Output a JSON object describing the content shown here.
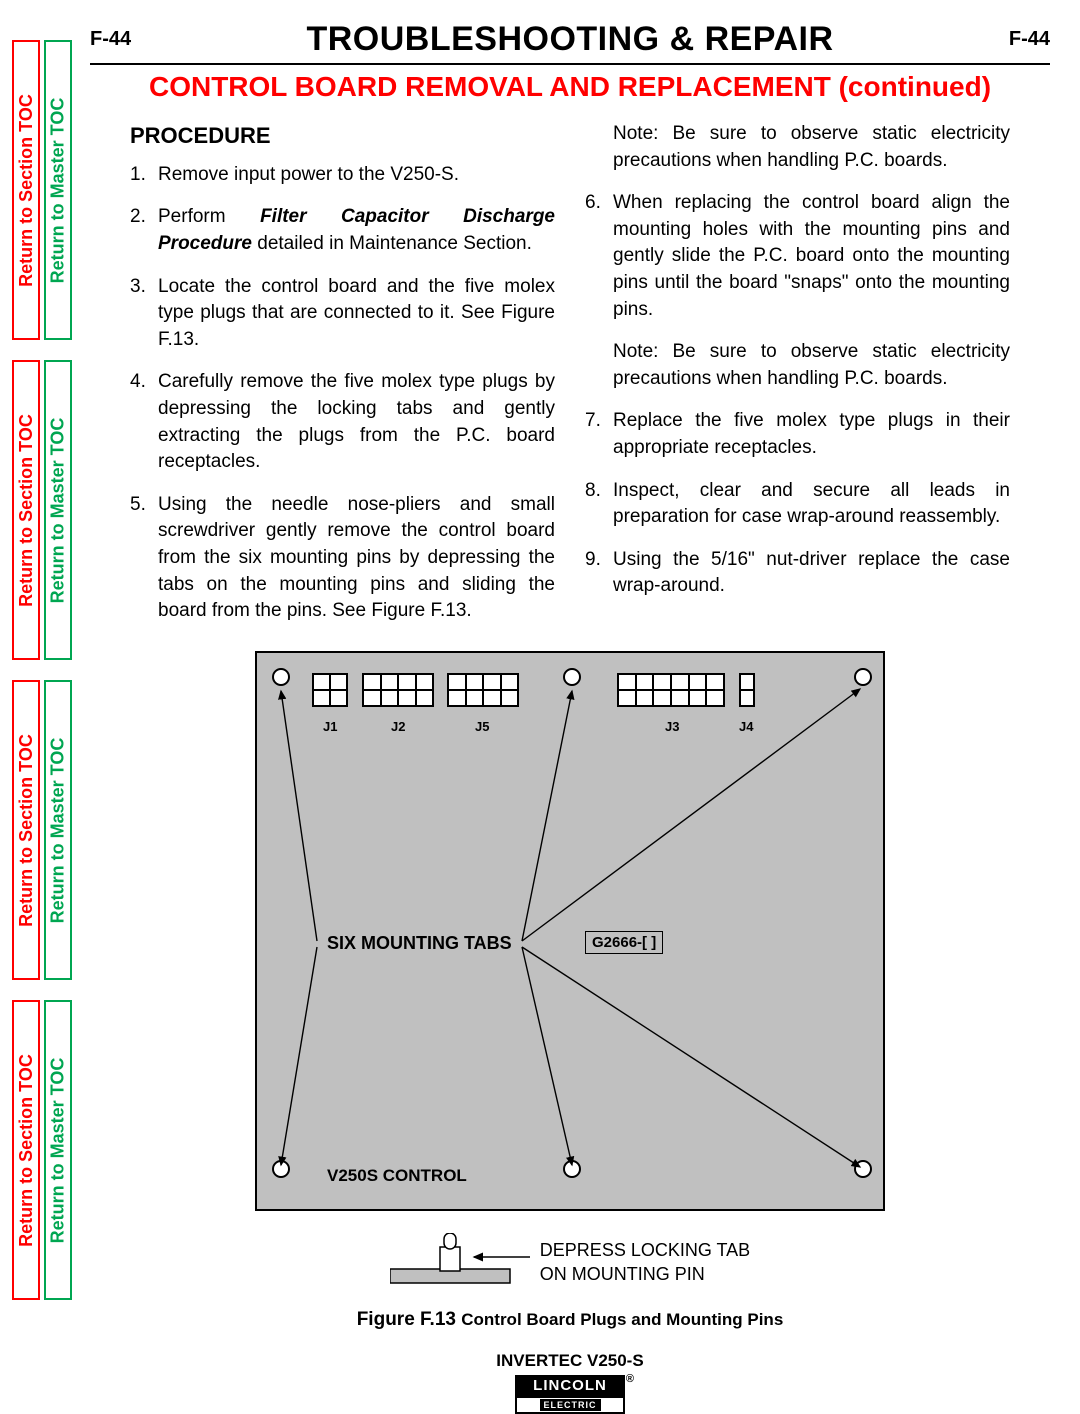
{
  "nav": {
    "section": "Return to Section TOC",
    "master": "Return to Master TOC"
  },
  "header": {
    "page_left": "F-44",
    "title": "TROUBLESHOOTING & REPAIR",
    "page_right": "F-44",
    "subtitle": "CONTROL BOARD REMOVAL AND REPLACEMENT (continued)"
  },
  "procedure": {
    "heading": "PROCEDURE",
    "left": {
      "s1": "Remove input power to the V250-S.",
      "s2a": "Perform ",
      "s2b": "Filter Capacitor Discharge Procedure",
      "s2c": " detailed in Maintenance Section.",
      "s3": "Locate the control board and the five molex type plugs that are connected to it.  See Figure F.13.",
      "s4": "Carefully remove the five molex type plugs by depressing the locking tabs and gently extracting the plugs from the P.C.  board receptacles.",
      "s5": "Using the needle nose-pliers and small screwdriver gently remove the control board from the six mounting pins by depressing the tabs on the mounting pins and sliding the board from the pins. See Figure F.13."
    },
    "right": {
      "note1": "Note:  Be sure to observe static electricity precautions when handling P.C. boards.",
      "s6": "When replacing the control board align the mounting holes with the mounting pins and gently slide the P.C. board onto the mounting pins until the board \"snaps\" onto the mounting pins.",
      "note2": "Note:  Be sure to observe static electricity precautions when handling P.C. boards.",
      "s7": "Replace the five molex type plugs in their appropriate receptacles.",
      "s8": "Inspect, clear and secure all leads in preparation for case wrap-around reassembly.",
      "s9": "Using  the 5/16\" nut-driver replace the case wrap-around."
    }
  },
  "figure": {
    "jlabels": {
      "j1": "J1",
      "j2": "J2",
      "j5": "J5",
      "j3": "J3",
      "j4": "J4"
    },
    "tabs_label": "SIX MOUNTING TABS",
    "gbox": "G2666-[ ]",
    "ctrl": "V250S CONTROL",
    "pin_text1": "DEPRESS LOCKING TAB",
    "pin_text2": "ON MOUNTING PIN",
    "caption_bold": "Figure F.13 ",
    "caption_rest": "Control Board Plugs and Mounting Pins"
  },
  "footer": {
    "model": "INVERTEC V250-S",
    "logo_top": "LINCOLN",
    "logo_bot": "ELECTRIC"
  }
}
